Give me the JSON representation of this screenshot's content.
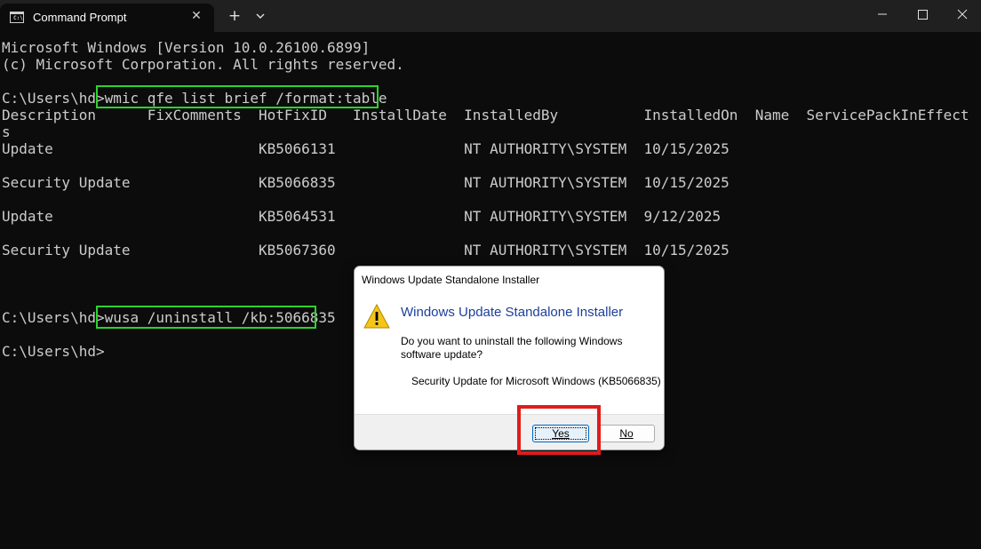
{
  "window": {
    "tab_title": "Command Prompt",
    "tab_close_glyph": "✕",
    "new_tab_glyph": "+",
    "icons": [
      "cmd-icon",
      "close-icon",
      "plus-icon",
      "chevron-down-icon",
      "minimize-icon",
      "maximize-icon",
      "window-close-icon"
    ]
  },
  "console": {
    "lines": [
      "Microsoft Windows [Version 10.0.26100.6899]",
      "(c) Microsoft Corporation. All rights reserved.",
      "",
      "C:\\Users\\hd>wmic qfe list brief /format:table",
      "Description      FixComments  HotFixID   InstallDate  InstalledBy          InstalledOn  Name  ServicePackInEffect  Statu",
      "s",
      "Update                        KB5066131               NT AUTHORITY\\SYSTEM  10/15/2025",
      "",
      "Security Update               KB5066835               NT AUTHORITY\\SYSTEM  10/15/2025",
      "",
      "Update                        KB5064531               NT AUTHORITY\\SYSTEM  9/12/2025",
      "",
      "Security Update               KB5067360               NT AUTHORITY\\SYSTEM  10/15/2025",
      "",
      "",
      "",
      "C:\\Users\\hd>wusa /uninstall /kb:5066835",
      "",
      "C:\\Users\\hd>"
    ]
  },
  "dialog": {
    "title": "Windows Update Standalone Installer",
    "heading": "Windows Update Standalone Installer",
    "question": "Do you want to uninstall the following Windows software update?",
    "update_name": "Security Update for Microsoft Windows (KB5066835)",
    "yes_label": "Yes",
    "no_label": "No",
    "icon": "warning-icon"
  },
  "colors": {
    "background": "#0c0c0c",
    "text": "#cccccc",
    "command_highlight": "#2bd42b",
    "button_highlight": "#e01b1b",
    "dialog_heading": "#1c3f9c"
  }
}
